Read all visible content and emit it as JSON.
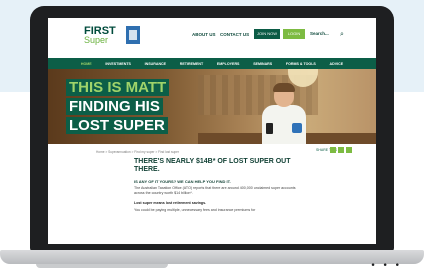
{
  "site": {
    "logo": {
      "line1": "FIRST",
      "line2": "Super"
    },
    "toplinks": [
      "ABOUT US",
      "CONTACT US"
    ],
    "join_label": "JOIN NOW",
    "login_label": "LOGIN",
    "search_label": "Search...",
    "nav": [
      "HOME",
      "INVESTMENTS",
      "INSURANCE",
      "RETIREMENT",
      "EMPLOYERS",
      "SEMINARS",
      "FORMS & TOOLS",
      "ADVICE"
    ]
  },
  "hero": {
    "line1": "THIS IS MATT",
    "line2": "FINDING HIS",
    "line3": "LOST SUPER"
  },
  "content": {
    "breadcrumb": "Home > Superannuation > Find my super > Find lost super",
    "share_label": "SHARE THIS",
    "heading": "THERE'S NEARLY $14B* OF LOST SUPER OUT THERE.",
    "subhead": "IS ANY OF IT YOURS? WE CAN HELP YOU FIND IT.",
    "para1": "The Australian Taxation Office (ATO) reports that there are around 400,000 unclaimed super accounts across the country worth $14 billion*.",
    "para2": "Lost super means lost retirement savings.",
    "para3": "You could be paying multiple, unnecessary fees and insurance premiums for"
  },
  "colors": {
    "brand_green": "#0c5e47",
    "accent_green": "#9fd36a",
    "login_green": "#7dbb42"
  },
  "device": {
    "menu_dots": "• • •"
  }
}
